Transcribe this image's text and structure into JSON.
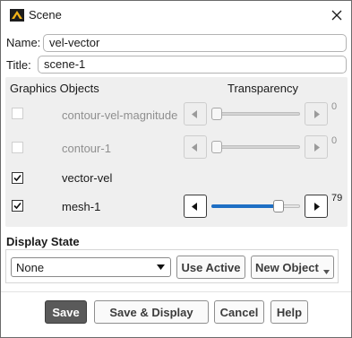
{
  "window": {
    "title": "Scene",
    "icon": "ansys-logo-icon",
    "close_icon": "close-icon"
  },
  "fields": {
    "name_label": "Name:",
    "name_value": "vel-vector",
    "title_label": "Title:",
    "title_value": "scene-1"
  },
  "graphics": {
    "header_objects": "Graphics Objects",
    "header_transparency": "Transparency",
    "objects": [
      {
        "name": "contour-vel-magnitude",
        "checked": false,
        "enabled": false,
        "transparency": "0"
      },
      {
        "name": "contour-1",
        "checked": false,
        "enabled": false,
        "transparency": "0"
      },
      {
        "name": "vector-vel",
        "checked": true,
        "enabled": true
      },
      {
        "name": "mesh-1",
        "checked": true,
        "enabled": true,
        "transparency": "79",
        "transparency_level": 0.79
      }
    ]
  },
  "display_state": {
    "title": "Display State",
    "selected": "None",
    "use_active_label": "Use Active",
    "new_object_label": "New Object"
  },
  "actions": {
    "save_label": "Save",
    "save_display_label": "Save & Display",
    "cancel_label": "Cancel",
    "help_label": "Help"
  },
  "colors": {
    "accent": "#1e6fc4",
    "primary_button": "#5a5a5a",
    "panel": "#efefef"
  }
}
